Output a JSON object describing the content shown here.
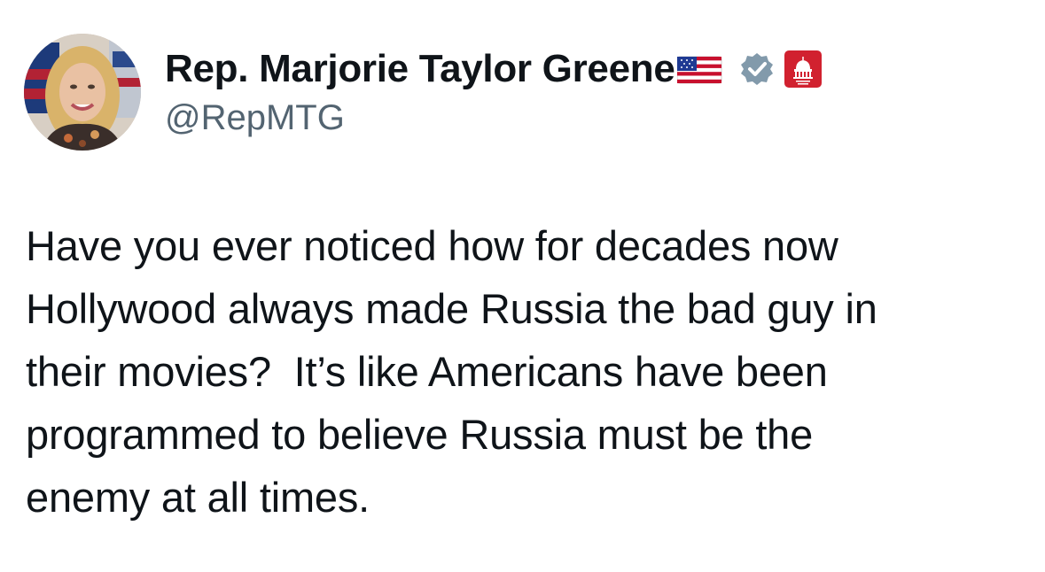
{
  "author": {
    "display_name": "Rep. Marjorie Taylor Greene",
    "handle": "@RepMTG",
    "name_emoji": "us-flag-icon",
    "verified_badge": "verified-badge-icon",
    "affiliation_badge": "gop-badge-icon",
    "verified_color": "#829aab",
    "affiliation_color": "#d1212f"
  },
  "tweet": {
    "lines": [
      "Have you ever noticed how for decades now",
      "Hollywood always made Russia the bad guy in",
      "their movies?  It’s like Americans have been",
      "programmed to believe Russia must be the",
      "enemy at all times."
    ]
  }
}
